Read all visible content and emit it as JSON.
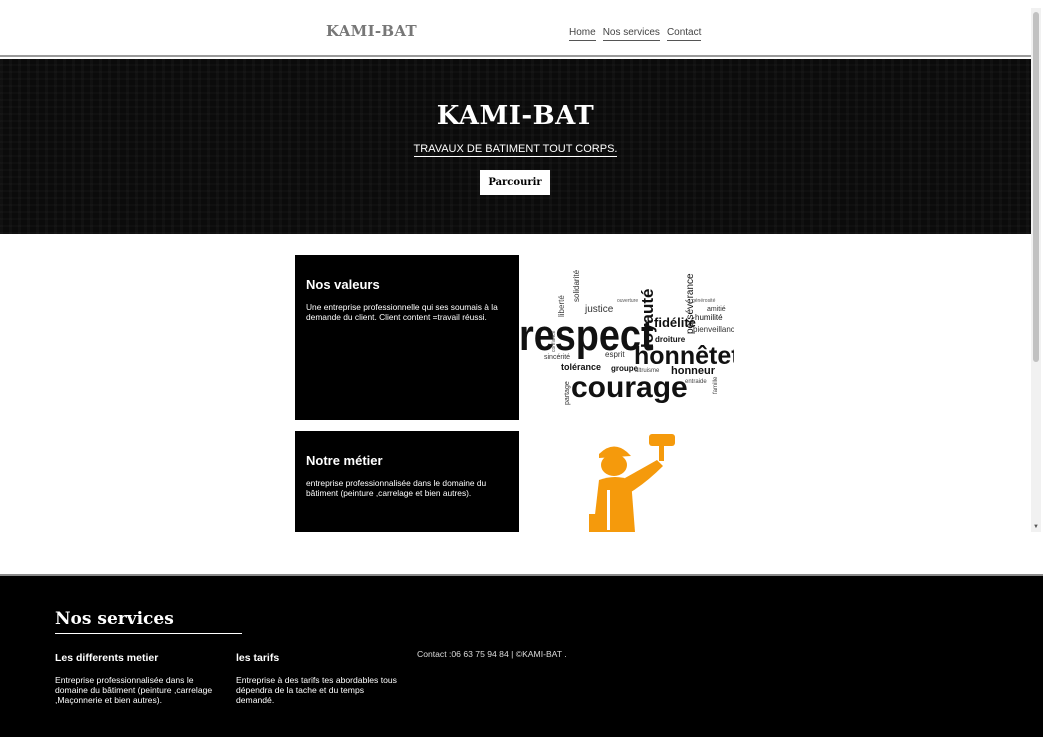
{
  "header": {
    "logo": "KAMI-BAT",
    "nav": [
      "Home",
      "Nos services",
      "Contact"
    ]
  },
  "hero": {
    "title": "KAMI-BAT",
    "subtitle": "TRAVAUX DE BATIMENT TOUT CORPS.",
    "button": "Parcourir"
  },
  "cards": [
    {
      "title": "Nos valeurs",
      "text": "Une entreprise professionnelle qui ses soumais à la demande du client. Client content =travail réussi."
    },
    {
      "title": "Notre métier",
      "text": "entreprise professionnalisée dans le domaine du bâtiment (peinture ,carrelage et bien autres)."
    }
  ],
  "wordcloud": {
    "words": [
      "respect",
      "loyauté",
      "honnêteté",
      "courage",
      "fidélité",
      "justice",
      "solidarité",
      "liberté",
      "persévérance",
      "humilité",
      "bienveillance",
      "droiture",
      "esprit",
      "tolérance",
      "groupe",
      "honneur",
      "sincérité",
      "partage",
      "entraide",
      "famille",
      "amitié",
      "confiance",
      "générosité",
      "altruisme",
      "ouverture"
    ]
  },
  "footer": {
    "title": "Nos services",
    "col1": {
      "title": "Les differents metier",
      "text": "Entreprise professionnalisée dans le domaine du bâtiment (peinture ,carrelage ,Maçonnerie et bien autres)."
    },
    "col2": {
      "title": "les tarifs",
      "text": "Entreprise à des tarifs tes abordables tous dépendra de la tache et du temps demandé."
    },
    "contact": "Contact :06 63 75 94 84 | ©KAMI-BAT ."
  },
  "colors": {
    "dark": "#000000",
    "worker": "#f59a0c",
    "logo": "#777777"
  }
}
